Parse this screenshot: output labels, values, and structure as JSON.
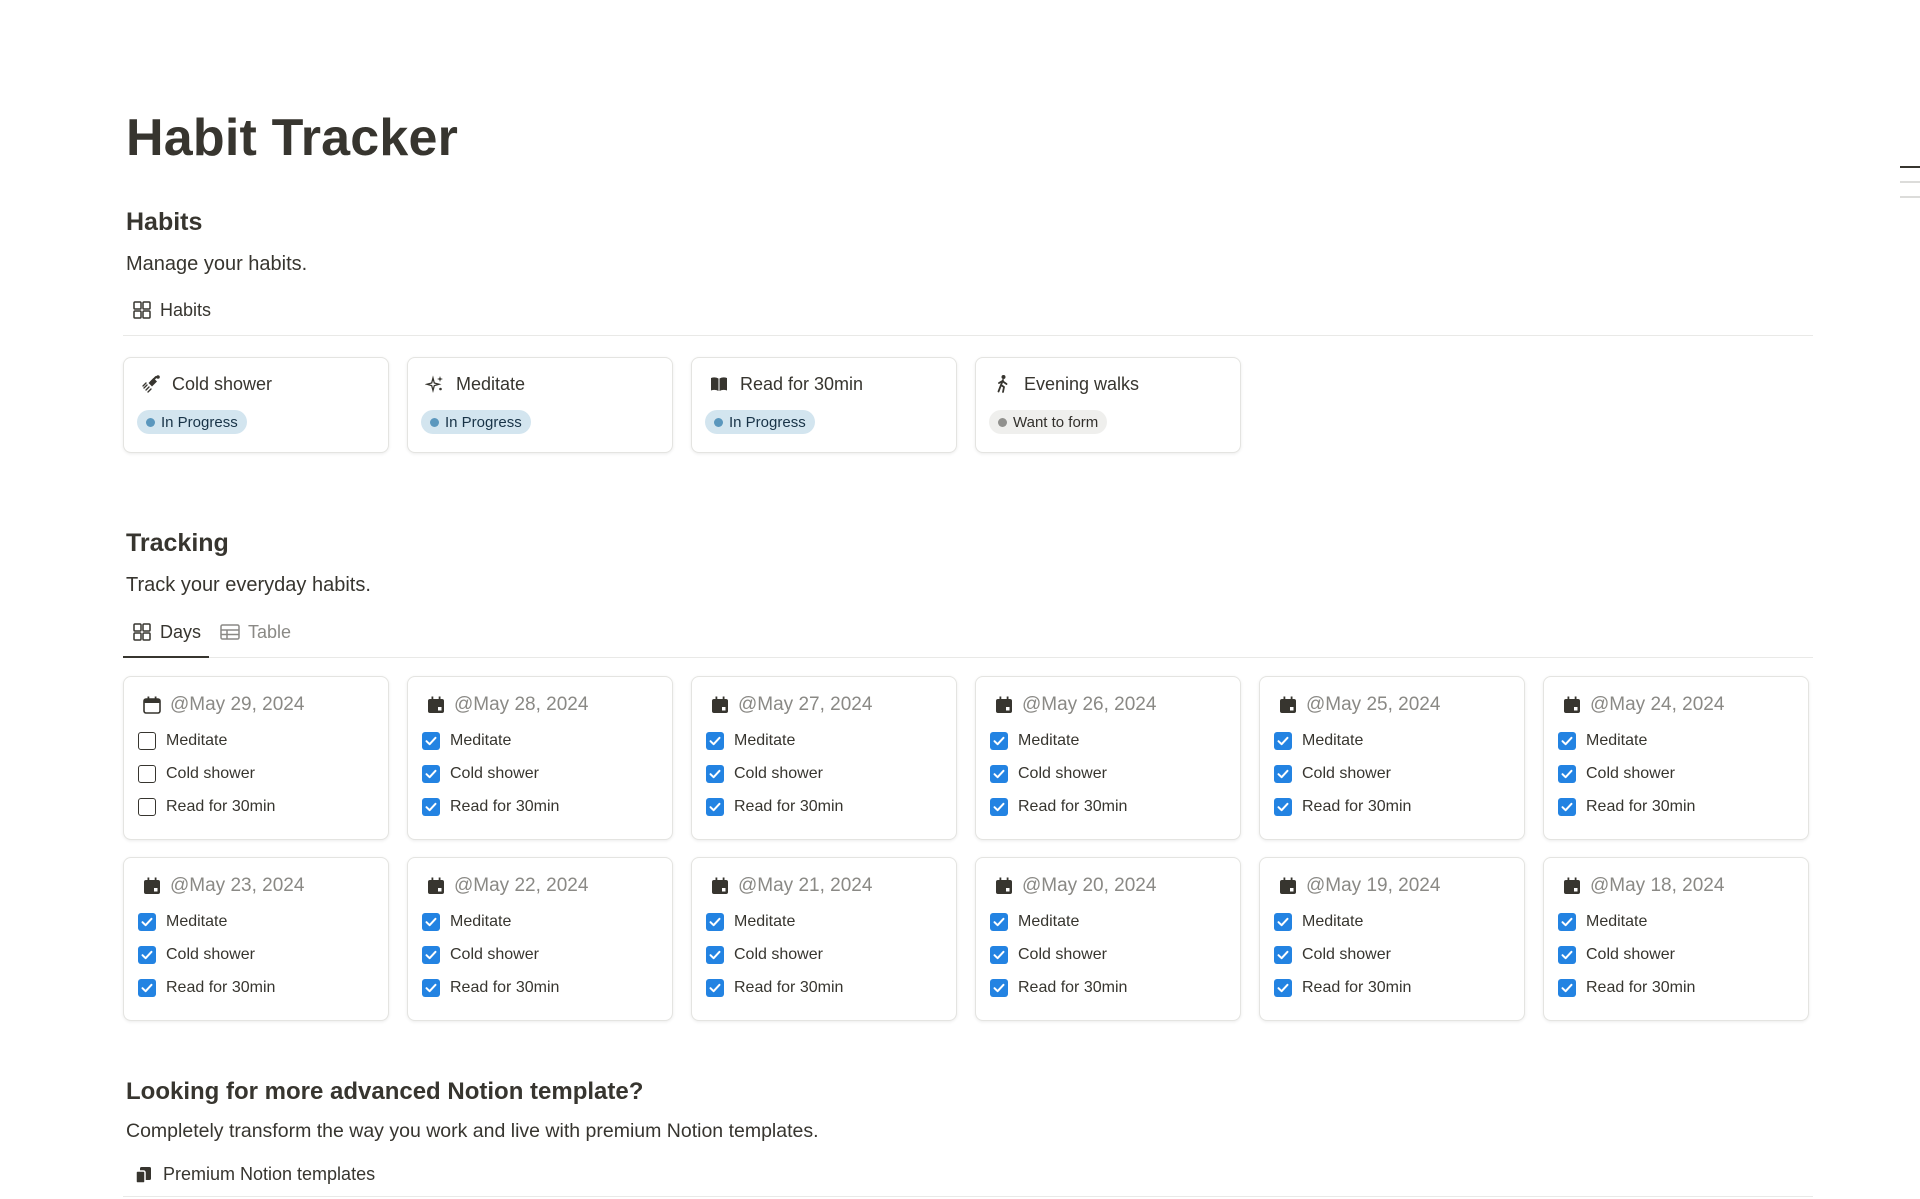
{
  "page": {
    "title": "Habit Tracker"
  },
  "habits_section": {
    "heading": "Habits",
    "description": "Manage your habits.",
    "view_tab": "Habits",
    "cards": [
      {
        "name": "Cold shower",
        "icon": "shower-icon",
        "status": "In Progress"
      },
      {
        "name": "Meditate",
        "icon": "sparkles-icon",
        "status": "In Progress"
      },
      {
        "name": "Read for 30min",
        "icon": "book-icon",
        "status": "In Progress"
      },
      {
        "name": "Evening walks",
        "icon": "walking-icon",
        "status": "Want to form"
      }
    ]
  },
  "tracking_section": {
    "heading": "Tracking",
    "description": "Track your everyday habits.",
    "tabs": [
      {
        "label": "Days",
        "active": true
      },
      {
        "label": "Table",
        "active": false
      }
    ],
    "days": [
      {
        "date": "@May 29, 2024",
        "Meditate": false,
        "Cold shower": false,
        "Read for 30min": false
      },
      {
        "date": "@May 28, 2024",
        "Meditate": true,
        "Cold shower": true,
        "Read for 30min": true
      },
      {
        "date": "@May 27, 2024",
        "Meditate": true,
        "Cold shower": true,
        "Read for 30min": true
      },
      {
        "date": "@May 26, 2024",
        "Meditate": true,
        "Cold shower": true,
        "Read for 30min": true
      },
      {
        "date": "@May 25, 2024",
        "Meditate": true,
        "Cold shower": true,
        "Read for 30min": true
      },
      {
        "date": "@May 24, 2024",
        "Meditate": true,
        "Cold shower": true,
        "Read for 30min": true
      },
      {
        "date": "@May 23, 2024",
        "Meditate": true,
        "Cold shower": true,
        "Read for 30min": true
      },
      {
        "date": "@May 22, 2024",
        "Meditate": true,
        "Cold shower": true,
        "Read for 30min": true
      },
      {
        "date": "@May 21, 2024",
        "Meditate": true,
        "Cold shower": true,
        "Read for 30min": true
      },
      {
        "date": "@May 20, 2024",
        "Meditate": true,
        "Cold shower": true,
        "Read for 30min": true
      },
      {
        "date": "@May 19, 2024",
        "Meditate": true,
        "Cold shower": true,
        "Read for 30min": true
      },
      {
        "date": "@May 18, 2024",
        "Meditate": true,
        "Cold shower": true,
        "Read for 30min": true
      }
    ],
    "habit_fields": [
      "Meditate",
      "Cold shower",
      "Read for 30min"
    ]
  },
  "promo_section": {
    "heading": "Looking for more advanced Notion template?",
    "description": "Completely transform the way you work and live with premium Notion templates.",
    "link_label": "Premium Notion templates"
  },
  "colors": {
    "text": "#37352f",
    "checkbox_checked": "#2383e2",
    "status_in_progress_bg": "#d3e5ef",
    "status_want_bg": "#efefed"
  }
}
